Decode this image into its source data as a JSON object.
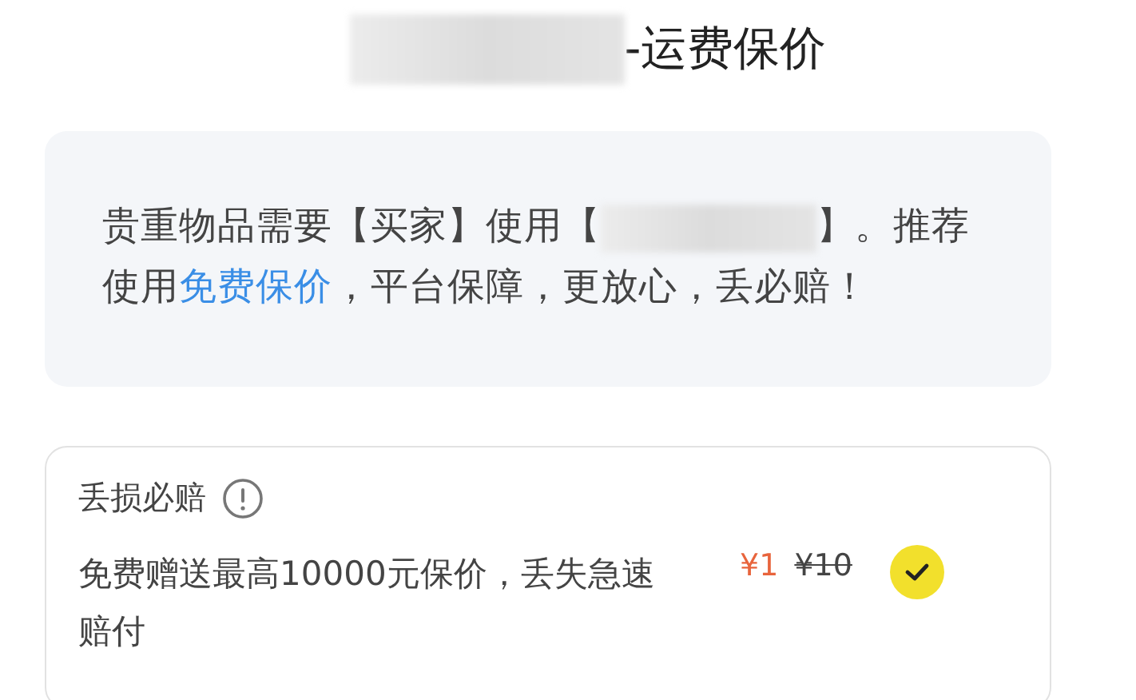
{
  "header": {
    "title": "-运费保价"
  },
  "notice": {
    "text_before": "贵重物品需要【买家】使用【",
    "text_after": "】。推荐使用",
    "link": "免费保价",
    "text_end": "，平台保障，更放心，丢必赔！"
  },
  "options": [
    {
      "title": "丢损必赔",
      "description": "免费赠送最高10000元保价，丢失急速赔付",
      "price": "¥1",
      "original_price": "¥10",
      "selected": true
    }
  ]
}
